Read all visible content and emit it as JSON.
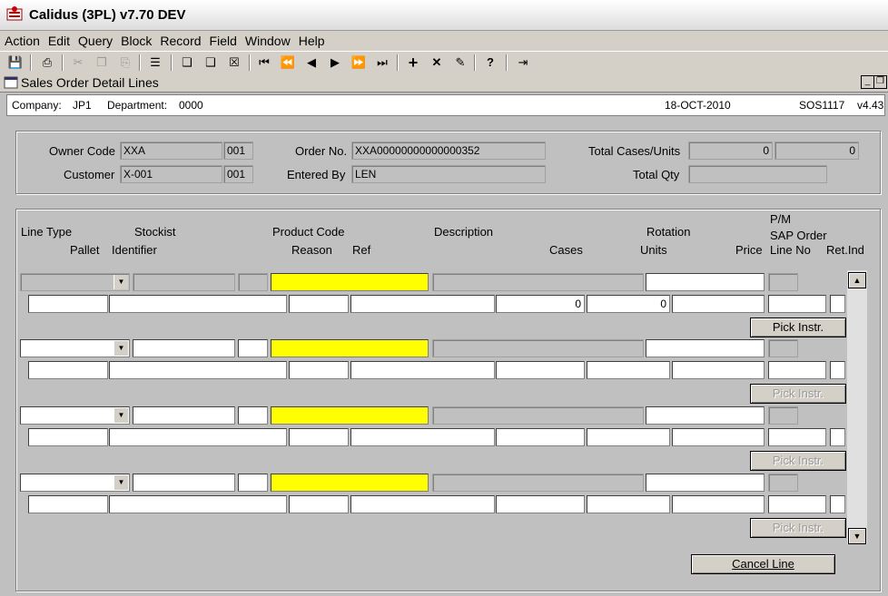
{
  "window": {
    "title": "Calidus (3PL) v7.70 DEV"
  },
  "menu": [
    "Action",
    "Edit",
    "Query",
    "Block",
    "Record",
    "Field",
    "Window",
    "Help"
  ],
  "toolbar": [
    "save-icon",
    "print-icon",
    "cut-icon",
    "copy-icon",
    "paste-icon",
    "list-icon",
    "clear-form-icon",
    "query-icon",
    "cancel-query-icon",
    "first-record-icon",
    "previous-block-icon",
    "previous-record-icon",
    "next-record-icon",
    "next-block-icon",
    "last-record-icon",
    "insert-record-icon",
    "delete-record-icon",
    "duplicate-record-icon",
    "help-icon",
    "exit-icon"
  ],
  "form": {
    "title": "Sales Order Detail Lines",
    "company_label": "Company:",
    "company": "JP1",
    "department_label": "Department:",
    "department": "0000",
    "date": "18-OCT-2010",
    "module": "SOS1117",
    "version": "v4.43"
  },
  "header": {
    "owner_code_label": "Owner Code",
    "owner_code": "XXA",
    "owner_code_suffix": "001",
    "customer_label": "Customer",
    "customer": "X-001",
    "customer_suffix": "001",
    "order_no_label": "Order No.",
    "order_no": "XXA00000000000000352",
    "entered_by_label": "Entered By",
    "entered_by": "LEN",
    "total_cases_label": "Total Cases/Units",
    "total_cases": "0",
    "total_units": "0",
    "total_qty_label": "Total Qty",
    "total_qty": ""
  },
  "columns": {
    "line_type": "Line Type",
    "stockist": "Stockist",
    "product_code": "Product Code",
    "description": "Description",
    "rotation": "Rotation",
    "pm": "P/M",
    "pallet": "Pallet",
    "identifier": "Identifier",
    "reason": "Reason",
    "ref": "Ref",
    "cases": "Cases",
    "units": "Units",
    "price": "Price",
    "sap_order_line_no": "SAP Order\nLine No",
    "ret_ind": "Ret.Ind"
  },
  "lines": [
    {
      "cases": "0",
      "units": "0",
      "pick_label": "Pick Instr.",
      "pick_enabled": true
    },
    {
      "cases": "",
      "units": "",
      "pick_label": "Pick Instr.",
      "pick_enabled": false
    },
    {
      "cases": "",
      "units": "",
      "pick_label": "Pick Instr.",
      "pick_enabled": false
    },
    {
      "cases": "",
      "units": "",
      "pick_label": "Pick Instr.",
      "pick_enabled": false
    }
  ],
  "cancel_line_label": "Cancel Line",
  "colors": {
    "highlight": "#ffff00",
    "background": "#c0c0c0"
  }
}
